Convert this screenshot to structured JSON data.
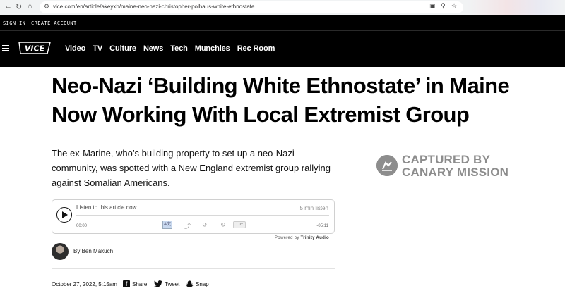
{
  "browser": {
    "url": "vice.com/en/article/akeyxb/maine-neo-nazi-christopher-polhaus-white-ethnostate"
  },
  "topbar": {
    "sign_in": "SIGN IN",
    "create_account": "CREATE ACCOUNT"
  },
  "nav": {
    "items": [
      {
        "label": "Video"
      },
      {
        "label": "TV"
      },
      {
        "label": "Culture"
      },
      {
        "label": "News"
      },
      {
        "label": "Tech"
      },
      {
        "label": "Munchies"
      },
      {
        "label": "Rec Room"
      }
    ]
  },
  "article": {
    "headline_line1": "Neo-Nazi ‘Building White Ethnostate’ in Maine",
    "headline_line2": "Now Working With Local Extremist Group",
    "dek": "The ex-Marine, who’s building property to set up a neo-Nazi community, was spotted with a New England extremist group rallying against Somalian Americans.",
    "author_prefix": "By",
    "author_name": "Ben Makuch",
    "date": "October 27, 2022, 5:15am",
    "share_facebook": "Share",
    "share_twitter": "Tweet",
    "share_snapchat": "Snap"
  },
  "audio_player": {
    "label": "Listen to this article now",
    "duration": "5 min listen",
    "elapsed": "00:00",
    "remaining": "-05:11",
    "speed": "1.0x",
    "powered_by_prefix": "Powered by",
    "powered_by_name": "Trinity Audio",
    "progress_fraction": 0
  },
  "watermark": {
    "line1": "CAPTURED BY",
    "line2": "CANARY MISSION"
  },
  "colors": {
    "nav_bg": "#000000",
    "watermark": "#8d8d8d"
  }
}
